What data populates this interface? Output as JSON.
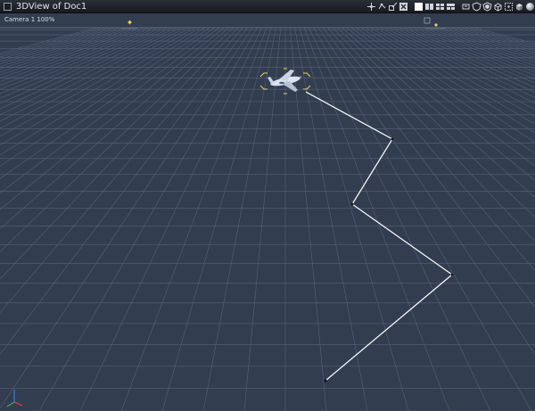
{
  "window": {
    "title": "3DView of Doc1"
  },
  "viewport": {
    "camera_label": "Camera 1 100%"
  },
  "toolbar": {
    "icons": [
      "move-object-icon",
      "rotate-object-icon",
      "scale-object-icon",
      "delete-icon",
      "single-view-icon",
      "two-views-icon",
      "four-views-icon",
      "three-views-icon",
      "render-preview-icon",
      "wireframe-shield-icon",
      "shaded-shield-icon",
      "box-icon",
      "bounding-box-icon",
      "flat-cube-icon",
      "smooth-sphere-icon"
    ]
  },
  "colors": {
    "background": "#333d50",
    "grid": "#56617a",
    "path": "#ffffff",
    "selection": "#e8d94a"
  }
}
